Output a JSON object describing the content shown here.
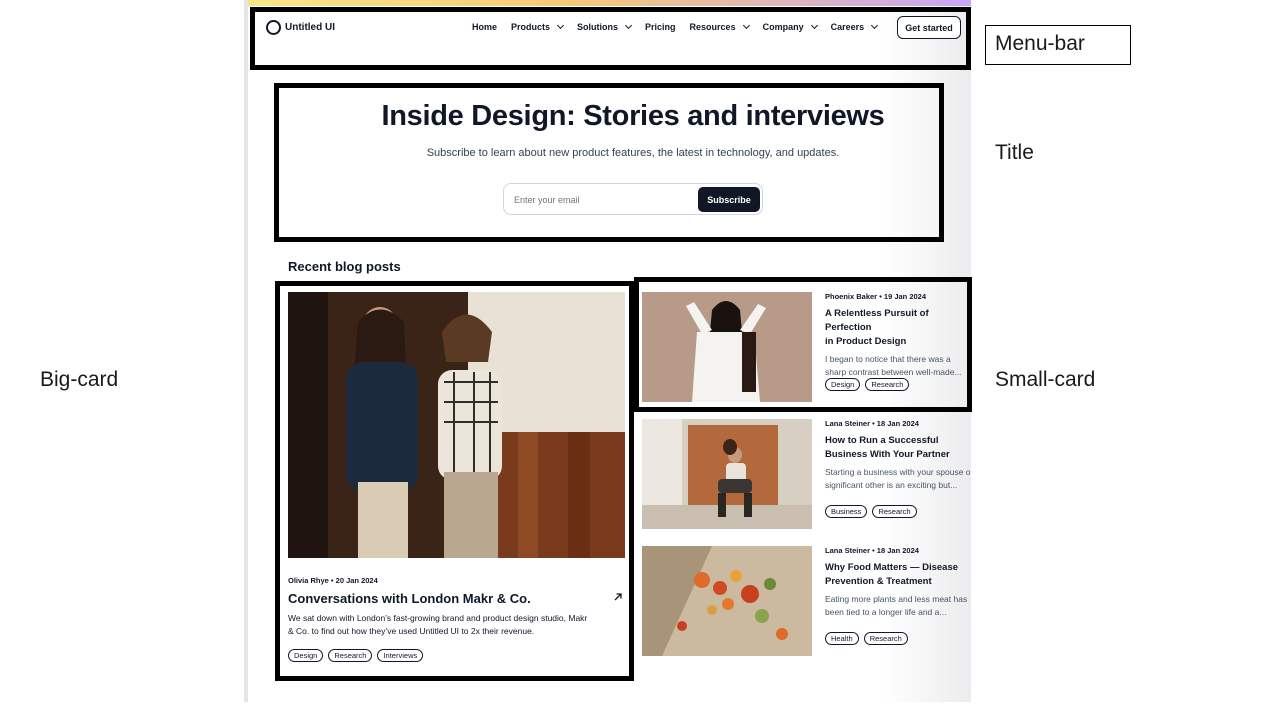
{
  "nav": {
    "logo": "Untitled UI",
    "items": [
      {
        "label": "Home",
        "dropdown": false
      },
      {
        "label": "Products",
        "dropdown": true
      },
      {
        "label": "Solutions",
        "dropdown": true
      },
      {
        "label": "Pricing",
        "dropdown": false
      },
      {
        "label": "Resources",
        "dropdown": true
      },
      {
        "label": "Company",
        "dropdown": true
      },
      {
        "label": "Careers",
        "dropdown": true
      }
    ],
    "cta": "Get started"
  },
  "hero": {
    "title": "Inside Design: Stories and interviews",
    "subtitle": "Subscribe to learn about new product features, the latest in technology, and updates.",
    "email_placeholder": "Enter your email",
    "subscribe_label": "Subscribe"
  },
  "section_title": "Recent blog posts",
  "big_post": {
    "meta": "Olivia Rhye • 20 Jan 2024",
    "title": "Conversations with London Makr & Co.",
    "description": "We sat down with London’s fast-growing brand and product design studio, Makr & Co. to find out how they’ve used Untitled UI to 2x their revenue.",
    "tags": [
      "Design",
      "Research",
      "Interviews"
    ]
  },
  "posts": [
    {
      "meta": "Phoenix Baker • 19 Jan 2024",
      "title": "A Relentless Pursuit of Perfection\nin Product Design",
      "description": "I began to notice that there was a\nsharp contrast between well-made...",
      "tags": [
        "Design",
        "Research"
      ]
    },
    {
      "meta": "Lana Steiner • 18 Jan 2024",
      "title": "How to Run a Successful\nBusiness With Your Partner",
      "description": "Starting a business with your spouse or\nsignificant other is an exciting but...",
      "tags": [
        "Business",
        "Research"
      ]
    },
    {
      "meta": "Lana Steiner • 18 Jan 2024",
      "title": "Why Food Matters — Disease\nPrevention & Treatment",
      "description": "Eating more plants and less meat has\nbeen tied to a longer life and a...",
      "tags": [
        "Health",
        "Research"
      ]
    }
  ],
  "annotations": {
    "menu_bar": "Menu-bar",
    "title": "Title",
    "big_card": "Big-card",
    "small_card": "Small-card"
  }
}
